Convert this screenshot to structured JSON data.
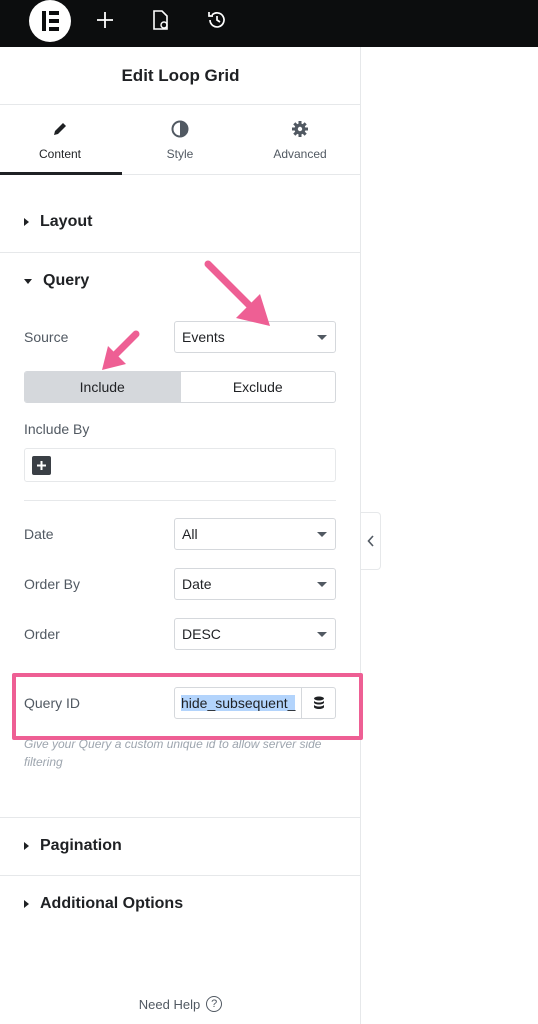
{
  "topbar": {
    "logo": "elementor-logo-icon",
    "buttons": [
      "plus-icon",
      "page-settings-icon",
      "history-icon"
    ]
  },
  "panel": {
    "title": "Edit Loop Grid",
    "tabs": [
      {
        "label": "Content",
        "icon": "pencil-icon",
        "active": true
      },
      {
        "label": "Style",
        "icon": "half-circle-icon",
        "active": false
      },
      {
        "label": "Advanced",
        "icon": "gear-icon",
        "active": false
      }
    ]
  },
  "sections": {
    "layout": {
      "label": "Layout",
      "expanded": false
    },
    "query": {
      "label": "Query",
      "expanded": true,
      "source": {
        "label": "Source",
        "value": "Events"
      },
      "include_exclude": {
        "include": "Include",
        "exclude": "Exclude",
        "selected": "Include"
      },
      "include_by": {
        "label": "Include By"
      },
      "date": {
        "label": "Date",
        "value": "All"
      },
      "order_by": {
        "label": "Order By",
        "value": "Date"
      },
      "order": {
        "label": "Order",
        "value": "DESC"
      },
      "query_id": {
        "label": "Query ID",
        "value": "hide_subsequent_",
        "help": "Give your Query a custom unique id to allow server side filtering"
      }
    },
    "pagination": {
      "label": "Pagination",
      "expanded": false
    },
    "additional_options": {
      "label": "Additional Options",
      "expanded": false
    }
  },
  "footer": {
    "need_help": "Need Help",
    "help_icon": "?"
  },
  "colors": {
    "annotation": "#ee5f94",
    "topbar": "#0c0d0e",
    "selection": "#b3d4fc"
  }
}
